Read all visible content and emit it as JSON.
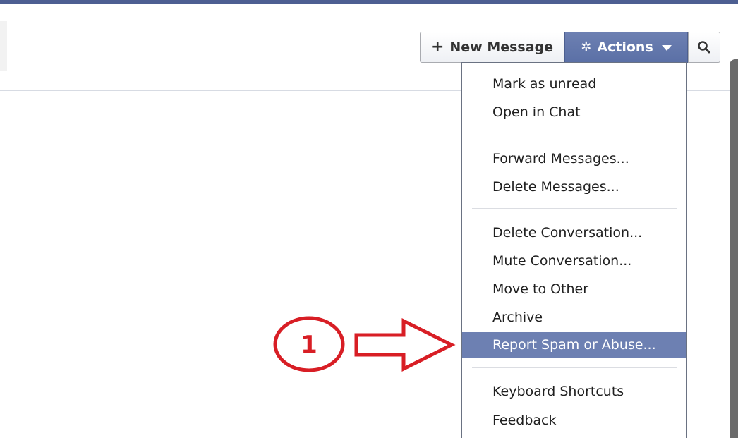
{
  "toolbar": {
    "new_message_label": "New Message",
    "new_message_icon": "plus-icon",
    "actions_label": "Actions",
    "actions_icon": "gear-icon",
    "actions_caret_icon": "caret-down-icon",
    "search_icon": "search-icon"
  },
  "actions_menu": {
    "items": [
      {
        "label": "Mark as unread"
      },
      {
        "label": "Open in Chat"
      },
      {
        "label": "Forward Messages..."
      },
      {
        "label": "Delete Messages..."
      },
      {
        "label": "Delete Conversation..."
      },
      {
        "label": "Mute Conversation..."
      },
      {
        "label": "Move to Other"
      },
      {
        "label": "Archive"
      },
      {
        "label": "Report Spam or Abuse...",
        "highlighted": true
      },
      {
        "label": "Keyboard Shortcuts"
      },
      {
        "label": "Feedback"
      }
    ]
  },
  "annotation": {
    "number": "1",
    "color": "#d81e25",
    "arrow_icon": "right-arrow-icon"
  },
  "colors": {
    "top_bar": "#4d5f92",
    "actions_button": "#6d80b2",
    "highlight": "#6d80b2"
  }
}
